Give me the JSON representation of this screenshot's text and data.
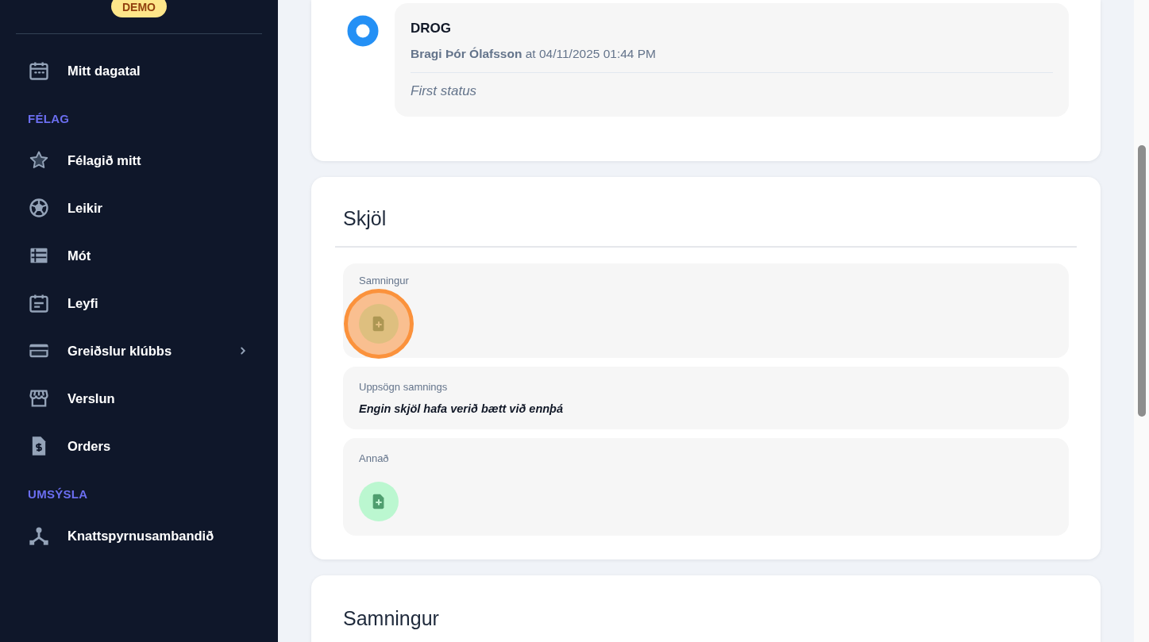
{
  "sidebar": {
    "badge": "DEMO",
    "nav": [
      {
        "kind": "link",
        "label": "Mitt dagatal"
      },
      {
        "kind": "section",
        "label": "FÉLAG"
      },
      {
        "kind": "link",
        "label": "Félagið mitt"
      },
      {
        "kind": "link",
        "label": "Leikir"
      },
      {
        "kind": "link",
        "label": "Mót"
      },
      {
        "kind": "link",
        "label": "Leyfi"
      },
      {
        "kind": "link",
        "label": "Greiðslur klúbbs",
        "expanded": false
      },
      {
        "kind": "link",
        "label": "Verslun"
      },
      {
        "kind": "link",
        "label": "Orders"
      },
      {
        "kind": "section",
        "label": "UMSÝSLA"
      },
      {
        "kind": "link",
        "label": "Knattspyrnusambandið"
      }
    ]
  },
  "status_history": {
    "entries": [
      {
        "status": "DROG",
        "byline": "**Bragi Þór Ólafsson** at 04/11/2025 01:44 PM",
        "note": "First status"
      }
    ]
  },
  "documents": {
    "title": "Skjöl",
    "groups": [
      {
        "kind": "upload",
        "label": "Samningur",
        "highlighted": true
      },
      {
        "kind": "empty",
        "label": "Uppsögn samnings",
        "message": "Engin skjöl hafa verið bætt við ennþá"
      },
      {
        "kind": "upload",
        "label": "Annað",
        "highlighted": false
      }
    ]
  },
  "contract": {
    "title": "Samningur"
  }
}
